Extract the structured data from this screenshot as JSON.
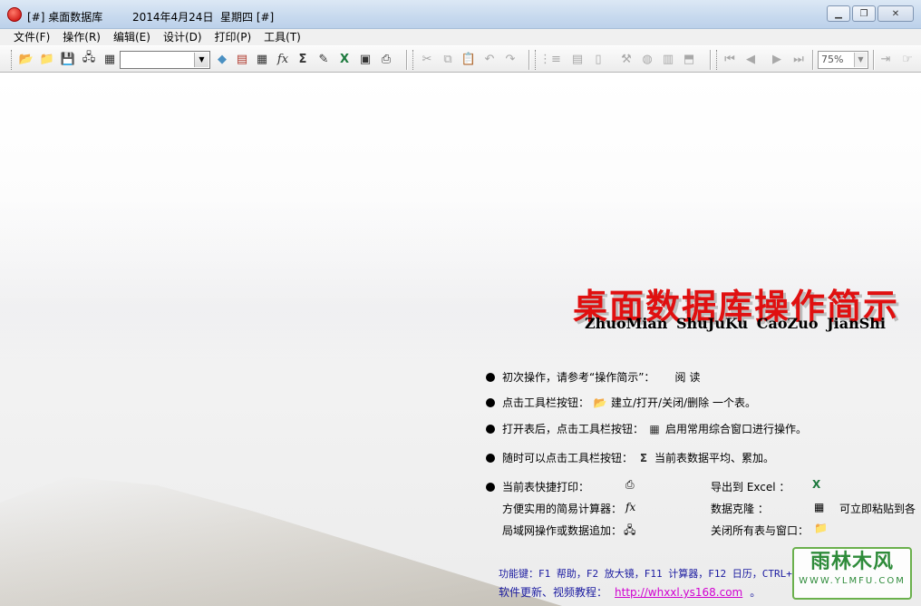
{
  "window": {
    "title_prefix": "[#] 桌面数据库",
    "date": "2014年4月24日",
    "weekday": "星期四 [#]"
  },
  "menu": [
    "文件(F)",
    "操作(R)",
    "编辑(E)",
    "设计(D)",
    "打印(P)",
    "工具(T)"
  ],
  "toolbar": {
    "combo_value": "",
    "zoom_value": "75%"
  },
  "intro": {
    "title": "桌面数据库操作简示",
    "pinyin": "ZhuoMian ShuJuKu CaoZuo JianShi"
  },
  "tips": {
    "t1": "初次操作，请参考“操作简示”：",
    "t1_link": "阅读",
    "t2_a": "点击工具栏按钮：",
    "t2_b": "建立/打开/关闭/删除 一个表。",
    "t3_a": "打开表后，点击工具栏按钮：",
    "t3_b": "启用常用综合窗口进行操作。",
    "t4_a": "随时可以点击工具栏按钮：",
    "t4_b": "当前表数据平均、累加。",
    "print": "当前表快捷打印：",
    "export": "导出到 Excel ：",
    "calc": "方便实用的简易计算器：",
    "clone": "数据克隆 ：",
    "paste": "可立即粘贴到各",
    "lan": "局域网操作或数据追加：",
    "closeall": "关闭所有表与窗口："
  },
  "footer": {
    "fnkeys": "功能键：F1 帮助，F2 放大镜，F11 计算器，F12 日历，CTRL+",
    "update_label": "软件更新、视频教程：",
    "url": "http://whxxl.ys168.com",
    "end": "。"
  },
  "watermark": {
    "main": "雨林木风",
    "sub": "WWW.YLMFU.COM"
  }
}
